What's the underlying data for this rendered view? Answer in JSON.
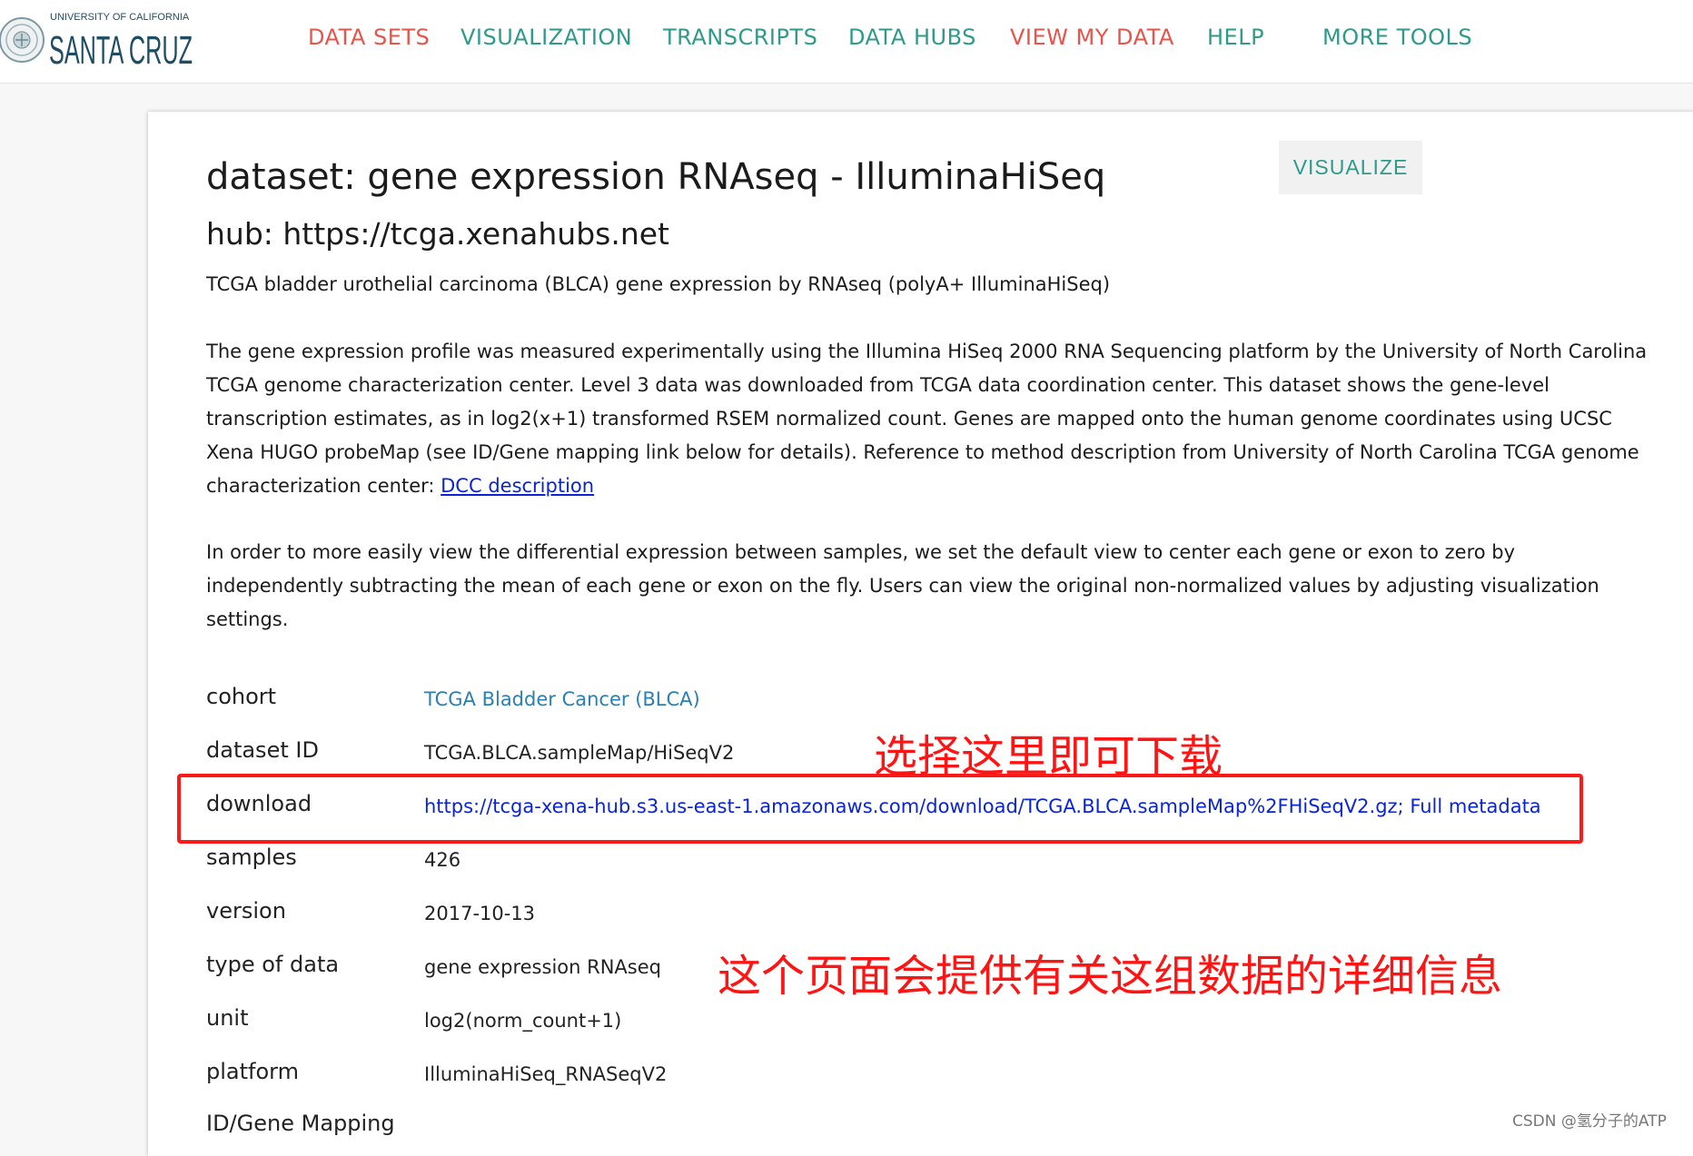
{
  "logo": {
    "line1": "UNIVERSITY OF CALIFORNIA",
    "line2": "SANTA CRUZ"
  },
  "colors": {
    "nav_red": "#e8534a",
    "nav_teal": "#2e9a8a",
    "link_blue": "#0b24d8",
    "cohort_blue": "#2a7fb3",
    "annotation_red": "#ff1414"
  },
  "nav": {
    "items": [
      {
        "label": "DATA SETS",
        "color": "#e8534a"
      },
      {
        "label": "VISUALIZATION",
        "color": "#2e9a8a"
      },
      {
        "label": "TRANSCRIPTS",
        "color": "#2e9a8a"
      },
      {
        "label": "DATA HUBS",
        "color": "#2e9a8a"
      },
      {
        "label": "VIEW MY DATA",
        "color": "#e8534a"
      },
      {
        "label": "HELP",
        "color": "#2e9a8a"
      },
      {
        "label": "MORE TOOLS",
        "color": "#2e9a8a"
      }
    ]
  },
  "dataset": {
    "visualize_label": "VISUALIZE",
    "title": "dataset: gene expression RNAseq - IlluminaHiSeq",
    "hub": "hub: https://tcga.xenahubs.net",
    "short_description": "TCGA bladder urothelial carcinoma (BLCA) gene expression by RNAseq (polyA+ IlluminaHiSeq)",
    "long_description": "The gene expression profile was measured experimentally using the Illumina HiSeq 2000 RNA Sequencing platform by the University of North Carolina TCGA genome characterization center. Level 3 data was downloaded from TCGA data coordination center. This dataset shows the gene-level transcription estimates, as in log2(x+1) transformed RSEM normalized count. Genes are mapped onto the human genome coordinates using UCSC Xena HUGO probeMap (see ID/Gene mapping link below for details). Reference to method description from University of North Carolina TCGA genome characterization center: ",
    "dcc_link": "DCC description",
    "note": "In order to more easily view the differential expression between samples, we set the default view to center each gene or exon to zero by independently subtracting the mean of each gene or exon on the fly. Users can view the original non-normalized values by adjusting visualization settings."
  },
  "meta": {
    "cohort_label": "cohort",
    "cohort_value": "TCGA Bladder Cancer (BLCA)",
    "id_label": "dataset ID",
    "id_value": "TCGA.BLCA.sampleMap/HiSeqV2",
    "download_label": "download",
    "download_url": "https://tcga-xena-hub.s3.us-east-1.amazonaws.com/download/TCGA.BLCA.sampleMap%2FHiSeqV2.gz",
    "download_sep": "; ",
    "download_full_metadata": "Full metadata",
    "samples_label": "samples",
    "samples_value": "426",
    "version_label": "version",
    "version_value": "2017-10-13",
    "type_label": "type of data",
    "type_value": "gene expression RNAseq",
    "unit_label": "unit",
    "unit_value": "log2(norm_count+1)",
    "platform_label": "platform",
    "platform_value": "IlluminaHiSeq_RNASeqV2",
    "mapping_label": "ID/Gene Mapping"
  },
  "annotations": {
    "download_hint": "选择这里即可下载",
    "page_hint": "这个页面会提供有关这组数据的详细信息"
  },
  "watermark": "CSDN @氢分子的ATP"
}
